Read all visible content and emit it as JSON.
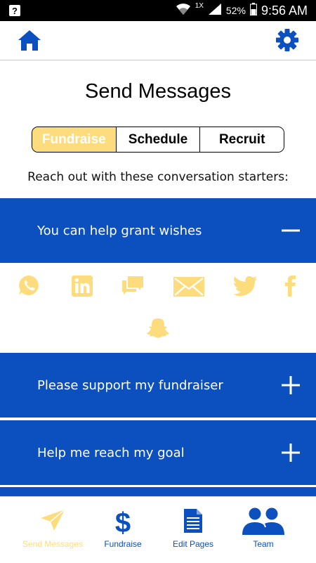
{
  "status_bar": {
    "signal_label": "1X",
    "battery": "52%",
    "time": "9:56 AM"
  },
  "colors": {
    "primary_blue": "#0c4fbe",
    "accent_yellow": "#fddc7e"
  },
  "header": {
    "home_icon": "home-icon",
    "settings_icon": "gear-icon"
  },
  "page": {
    "title": "Send Messages",
    "subtitle": "Reach out with these conversation starters:"
  },
  "segments": [
    {
      "label": "Fundraise",
      "active": true
    },
    {
      "label": "Schedule",
      "active": false
    },
    {
      "label": "Recruit",
      "active": false
    }
  ],
  "accordion": [
    {
      "label": "You can help grant wishes",
      "expanded": true,
      "icon": "minus-icon"
    },
    {
      "label": "Please support my fundraiser",
      "expanded": false,
      "icon": "plus-icon"
    },
    {
      "label": "Help me reach my goal",
      "expanded": false,
      "icon": "plus-icon"
    }
  ],
  "share_icons": [
    "whatsapp-icon",
    "linkedin-icon",
    "sms-icon",
    "email-icon",
    "twitter-icon",
    "facebook-icon",
    "snapchat-icon"
  ],
  "bottom_nav": [
    {
      "label": "Send Messages",
      "icon": "paper-plane-icon",
      "active": true
    },
    {
      "label": "Fundraise",
      "icon": "dollar-icon",
      "active": false
    },
    {
      "label": "Edit Pages",
      "icon": "document-icon",
      "active": false
    },
    {
      "label": "Team",
      "icon": "team-icon",
      "active": false
    }
  ]
}
